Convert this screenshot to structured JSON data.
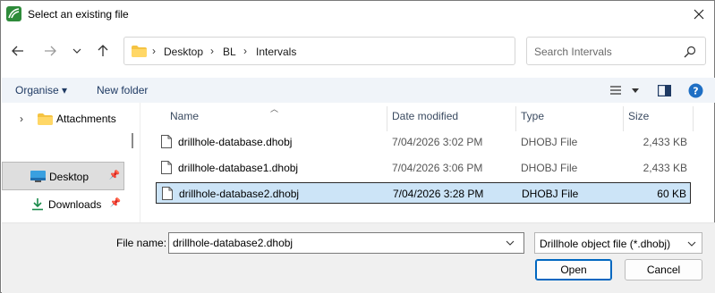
{
  "window": {
    "title": "Select an existing file"
  },
  "nav": {
    "breadcrumbs": [
      "Desktop",
      "BL",
      "Intervals"
    ],
    "search_placeholder": "Search Intervals"
  },
  "toolbar": {
    "organise_label": "Organise ▾",
    "new_folder_label": "New folder"
  },
  "left_pane": {
    "items": [
      {
        "label": "Attachments",
        "icon": "folder-icon"
      },
      {
        "label": "Desktop",
        "icon": "desktop-icon",
        "selected": true,
        "pinned": true
      },
      {
        "label": "Downloads",
        "icon": "download-icon",
        "pinned": true
      }
    ]
  },
  "columns": {
    "name": "Name",
    "date": "Date modified",
    "type": "Type",
    "size": "Size"
  },
  "files": [
    {
      "name": "drillhole-database.dhobj",
      "date": "7/04/2026 3:02 PM",
      "type": "DHOBJ File",
      "size": "2,433 KB"
    },
    {
      "name": "drillhole-database1.dhobj",
      "date": "7/04/2026 3:06 PM",
      "type": "DHOBJ File",
      "size": "2,433 KB"
    },
    {
      "name": "drillhole-database2.dhobj",
      "date": "7/04/2026 3:28 PM",
      "type": "DHOBJ File",
      "size": "60 KB",
      "selected": true
    }
  ],
  "bottom": {
    "filename_label": "File name:",
    "filename_value": "drillhole-database2.dhobj",
    "filter_value": "Drillhole object file (*.dhobj)",
    "open_label": "Open",
    "cancel_label": "Cancel"
  },
  "colors": {
    "accent": "#0067c0",
    "selection": "#cce4f7",
    "toolbar_bg": "#f0f4f9",
    "footer_bg": "#f0f0f0",
    "app_icon": "#2e8b3a"
  }
}
